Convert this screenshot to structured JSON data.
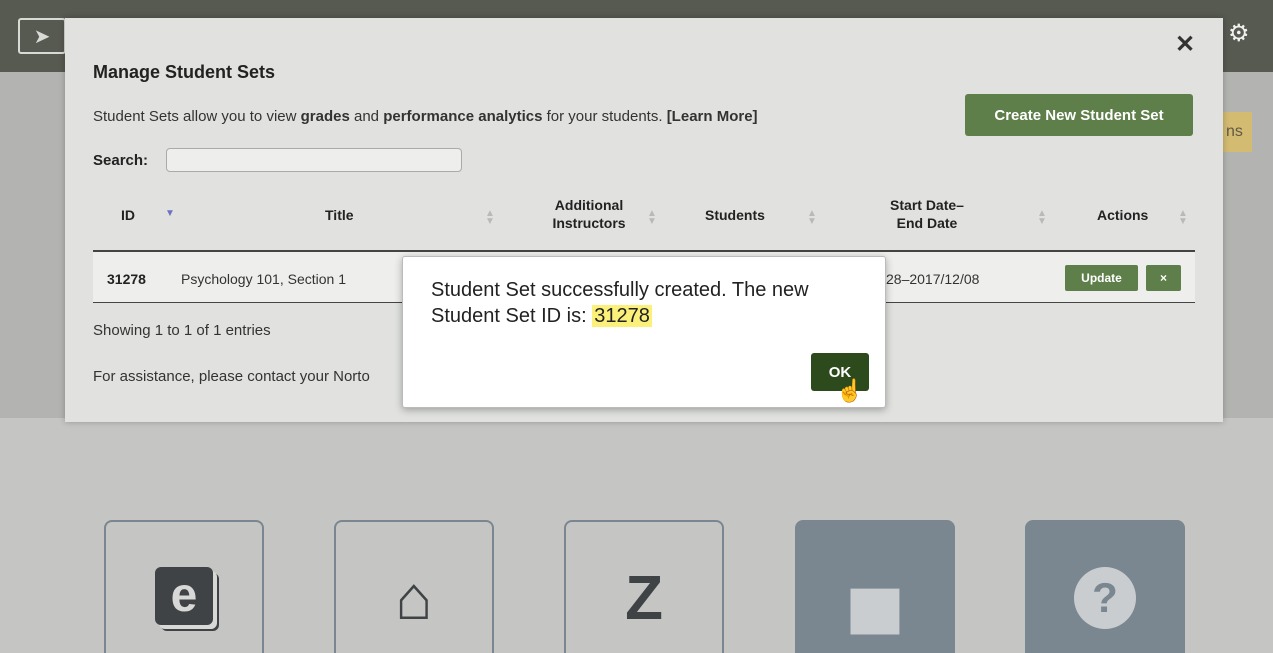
{
  "app": {
    "gear_icon": "gear-icon",
    "logo_icon": "logo-icon"
  },
  "background": {
    "badge_text": "ns",
    "tiles": [
      {
        "icon": "ebook-icon",
        "glyph": "e"
      },
      {
        "icon": "robot-icon",
        "glyph": "⌂"
      },
      {
        "icon": "z-logo-icon",
        "glyph": "Z"
      },
      {
        "icon": "bar-chart-icon",
        "glyph": "▅"
      },
      {
        "icon": "help-icon",
        "glyph": "?"
      }
    ]
  },
  "modal": {
    "title": "Manage Student Sets",
    "intro": {
      "part1": "Student Sets allow you to view ",
      "bold1": "grades",
      "part2": " and ",
      "bold2": "performance analytics",
      "part3": " for your students. ",
      "learn_more": "[Learn More]"
    },
    "create_button": "Create New Student Set",
    "search_label": "Search:",
    "search_value": "",
    "table": {
      "headers": [
        "ID",
        "Title",
        "Additional\nInstructors",
        "Students",
        "Start Date–\nEnd Date",
        "Actions"
      ],
      "rows": [
        {
          "id": "31278",
          "title": "Psychology 101, Section 1",
          "dates": "28–2017/12/08",
          "update_label": "Update",
          "delete_label": "×"
        }
      ]
    },
    "showing": "Showing 1 to 1 of 1 entries",
    "assistance": "For assistance, please contact your Norto"
  },
  "dialog": {
    "message": "Student Set successfully created. The new Student Set ID is: ",
    "set_id": "31278",
    "ok_label": "OK"
  },
  "colors": {
    "topbar": "#575a50",
    "primary_button": "#5e7f4a",
    "ok_button": "#2d4a1d",
    "highlight": "#fbf17a",
    "sort_active": "#6d73c0"
  }
}
